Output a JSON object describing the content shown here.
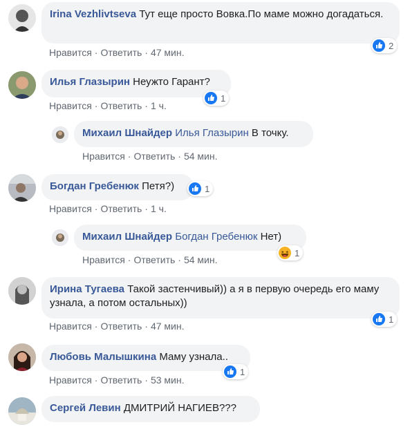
{
  "actions": {
    "like": "Нравится",
    "reply": "Ответить"
  },
  "comments": [
    {
      "author": "Irina Vezhlivtseva",
      "text": "Тут еще просто Вовка.По маме можно догадаться.",
      "time": "47 мин.",
      "reactions": "2",
      "reaction_icon": "like-icon"
    },
    {
      "author": "Илья Глазырин",
      "text": "Неужто Гарант?",
      "time": "1 ч.",
      "reactions": "1",
      "reaction_icon": "like-icon"
    },
    {
      "author": "Михаил Шнайдер",
      "mention": "Илья Глазырин",
      "text": "В точку.",
      "time": "54 мин.",
      "reply": true
    },
    {
      "author": "Богдан Гребенюк",
      "text": "Петя?)",
      "time": "1 ч.",
      "reactions": "1",
      "reaction_icon": "like-icon"
    },
    {
      "author": "Михаил Шнайдер",
      "mention": "Богдан Гребенюк",
      "text": "Нет)",
      "time": "54 мин.",
      "reply": true,
      "reactions": "1",
      "reaction_icon": "haha-icon"
    },
    {
      "author": "Ирина Тугаева",
      "text": "Такой застенчивый)) а я в первую очередь его маму узнала, а потом остальных))",
      "time": "47 мин.",
      "reactions": "1",
      "reaction_icon": "like-icon"
    },
    {
      "author": "Любовь Малышкина",
      "text": "Маму узнала..",
      "time": "53 мин.",
      "reactions": "1",
      "reaction_icon": "like-icon"
    },
    {
      "author": "Сергей Левин",
      "text": "ДМИТРИЙ НАГИЕВ???"
    }
  ],
  "colors": {
    "link": "#385898",
    "bubble": "#f2f3f5",
    "meta": "#606770",
    "like": "#1877f2",
    "haha": "#f7b125"
  }
}
